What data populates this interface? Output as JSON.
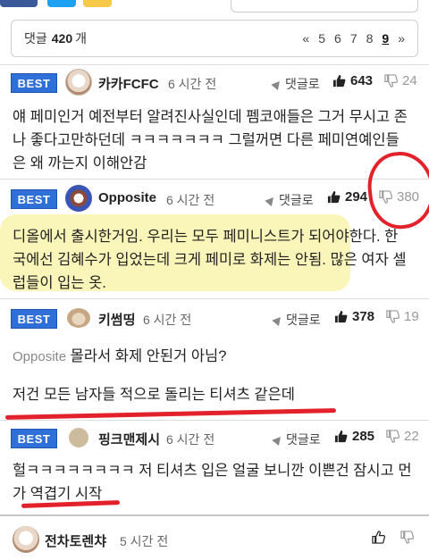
{
  "comments_header": {
    "label": "댓글",
    "count": "420",
    "unit": "개",
    "pages": [
      "«",
      "5",
      "6",
      "7",
      "8",
      "9",
      "»"
    ],
    "current_page": "9"
  },
  "comments": [
    {
      "badge": "BEST",
      "user": "카카FCFC",
      "time": "6 시간 전",
      "reply_label": "댓글로",
      "up": "643",
      "down": "24",
      "lines": [
        "얘 페미인거 예전부터 알려진사실인데 펨코애들은 그거 무시고 존",
        "나 좋다고만하던데 ㅋㅋㅋㅋㅋㅋㅋ 그럴꺼면 다른 페미연예인들",
        "은 왜 까는지 이해안감"
      ]
    },
    {
      "badge": "BEST",
      "user": "Opposite",
      "time": "6 시간 전",
      "reply_label": "댓글로",
      "up": "294",
      "down": "380",
      "lines": [
        "디올에서 출시한거임. 우리는 모두 페미니스트가 되어야한다. 한",
        "국에선 김혜수가 입었는데 크게 페미로 화제는 안됨. 많은 여자 셀",
        "럽들이 입는 옷."
      ]
    },
    {
      "badge": "BEST",
      "user": "키썸띵",
      "time": "6 시간 전",
      "reply_label": "댓글로",
      "up": "378",
      "down": "19",
      "mention": "Opposite",
      "lines": [
        "몰라서 화제 안된거 아님?",
        "",
        "저건 모든 남자들 적으로 돌리는 티셔츠 같은데"
      ]
    },
    {
      "badge": "BEST",
      "user": "핑크맨제시",
      "time": "6 시간 전",
      "reply_label": "댓글로",
      "up": "285",
      "down": "22",
      "lines": [
        "헐ㅋㅋㅋㅋㅋㅋㅋㅋ 저 티셔츠 입은 얼굴 보니깐 이쁜건 잠시고 먼",
        "가 역겹기 시작"
      ]
    },
    {
      "user": "전차토렌챠",
      "time": "5 시간 전"
    }
  ]
}
